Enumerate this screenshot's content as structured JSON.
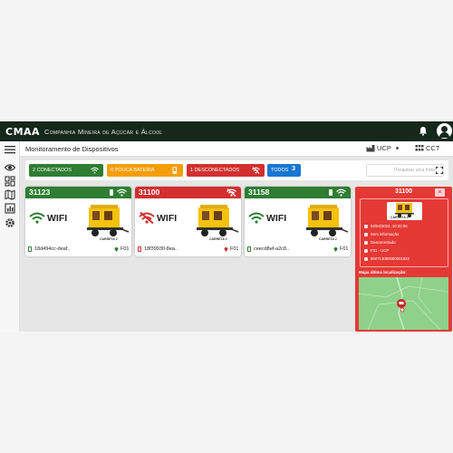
{
  "header": {
    "logo": "CMAA",
    "company": "Companhia Mineira de Açúcar e Álcool"
  },
  "subheader": {
    "title": "Monitoramento de Dispositivos",
    "unit_ucp": "UCP",
    "unit_cct": "CCT"
  },
  "filters": {
    "connected": "2 CONECTADOS",
    "low_battery": "0 POUCA BATERIA",
    "disconnected": "1 DESCONECTADOS",
    "all_label": "TODOS",
    "all_count": "3",
    "search_placeholder": "Pesquisar uma frota"
  },
  "cards": [
    {
      "id": "31123",
      "status": "connected",
      "wifi": "WIFI",
      "cart": "CARRETA 2",
      "imei": "18d494cc-deaf..",
      "location": "F01"
    },
    {
      "id": "31100",
      "status": "disconnected",
      "wifi": "WIFI",
      "cart": "CARRETA 2",
      "imei": "18f39930-8ea..",
      "location": "F01"
    },
    {
      "id": "31158",
      "status": "connected",
      "wifi": "WIFI",
      "cart": "CARRETA 2",
      "imei": "ceecd8ef-a2c8..",
      "location": "F01"
    }
  ],
  "panel": {
    "title": "31100",
    "close": "×",
    "cart": "CARRETA 2",
    "date": "04/04/2024, 10:32:06",
    "info": "Sem informação",
    "status": "Desconectado",
    "location": "F01 - UCP",
    "serial": "860713090000001922",
    "map_label": "Mapa última localização:"
  },
  "colors": {
    "green": "#2e7d32",
    "orange": "#f59e0b",
    "red": "#d32f2f",
    "blue": "#1976d2",
    "dark": "#16271c"
  }
}
